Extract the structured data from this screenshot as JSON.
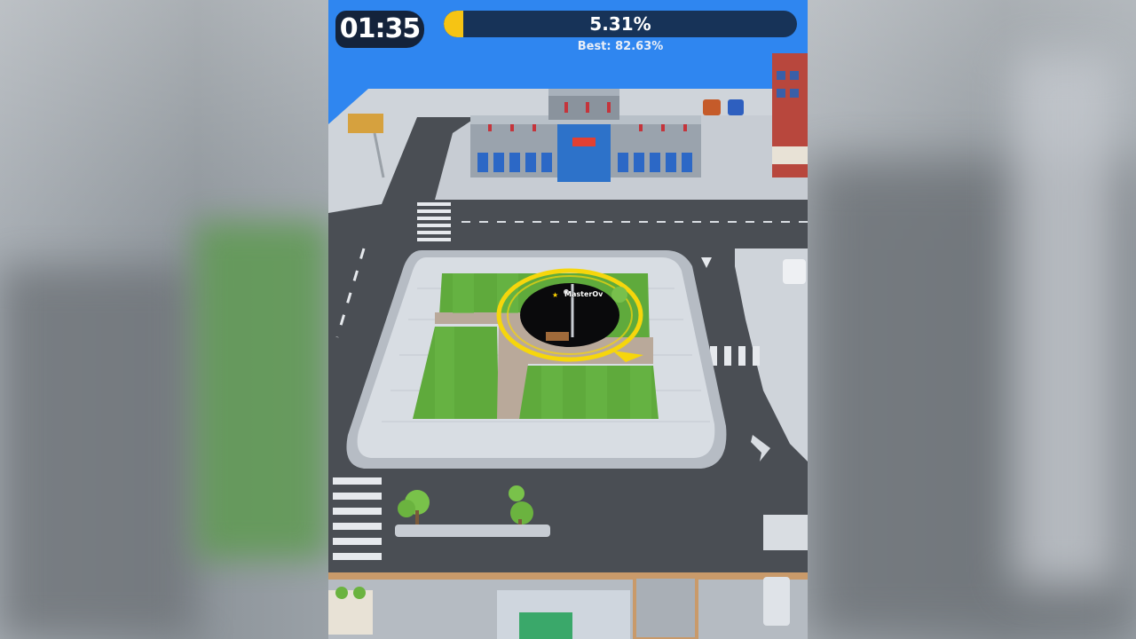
{
  "hud": {
    "timer": "01:35",
    "progress_label": "5.31%",
    "progress_fraction": 0.0531,
    "best_label": "Best: 82.63%"
  },
  "player": {
    "name": "MasterOv"
  },
  "colors": {
    "sky": "#2f86f0",
    "hud_dark": "#14233b",
    "progress_track": "#173358",
    "progress_fill": "#f6c414",
    "hole_ring": "#f6d60c",
    "grass": "#5faa3c",
    "road": "#4a4e54",
    "sidewalk": "#cfd4da"
  },
  "icons": {
    "crown": "crown-icon"
  }
}
